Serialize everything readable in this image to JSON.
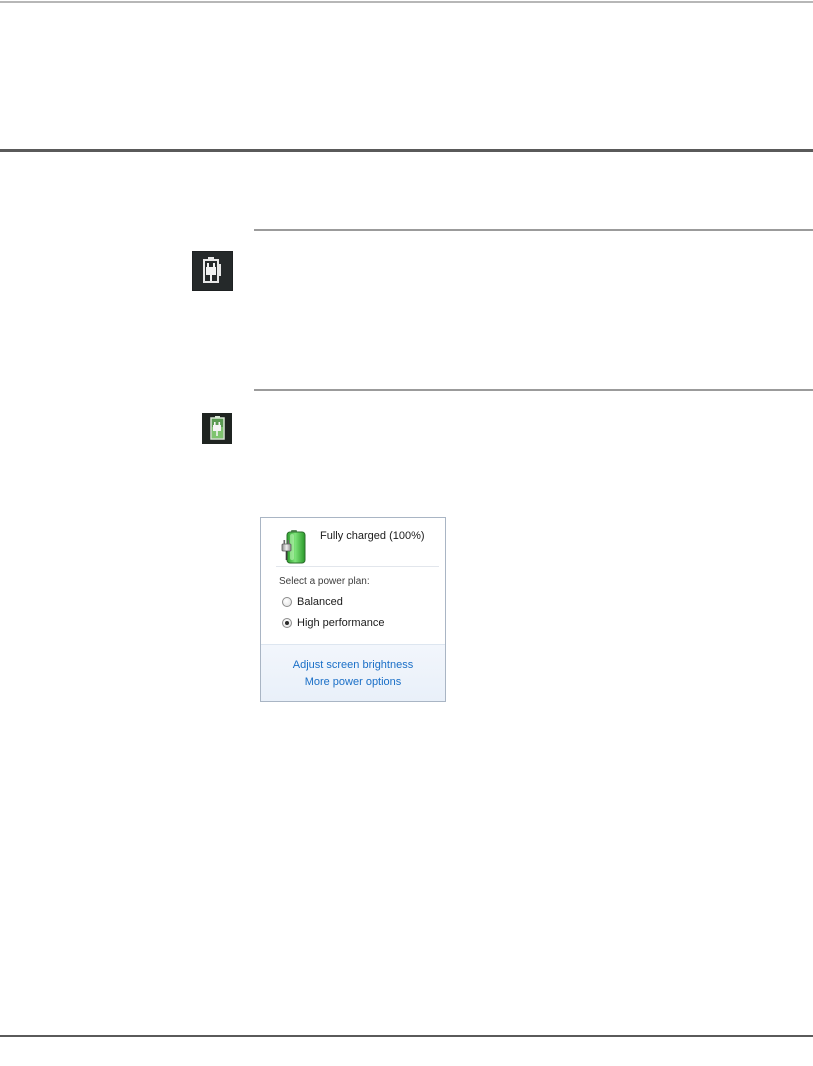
{
  "colors": {
    "header_rule": "#5a5a5a",
    "section_rule": "#9b9b9b",
    "link_blue": "#1a6fc7",
    "battery_green": "#3cc43c"
  },
  "icons": {
    "ac_tray_icon": "ac-power-plug-icon",
    "battery_tray_icon": "battery-plug-icon",
    "popup_status_icon": "battery-charged-icon"
  },
  "battery_popup": {
    "status_text": "Fully charged (100%)",
    "charge_percent": 100,
    "select_label": "Select a power plan:",
    "plans": [
      {
        "label": "Balanced",
        "selected": false
      },
      {
        "label": "High performance",
        "selected": true
      }
    ],
    "links": {
      "adjust_brightness": "Adjust screen brightness",
      "more_options": "More power options"
    }
  }
}
